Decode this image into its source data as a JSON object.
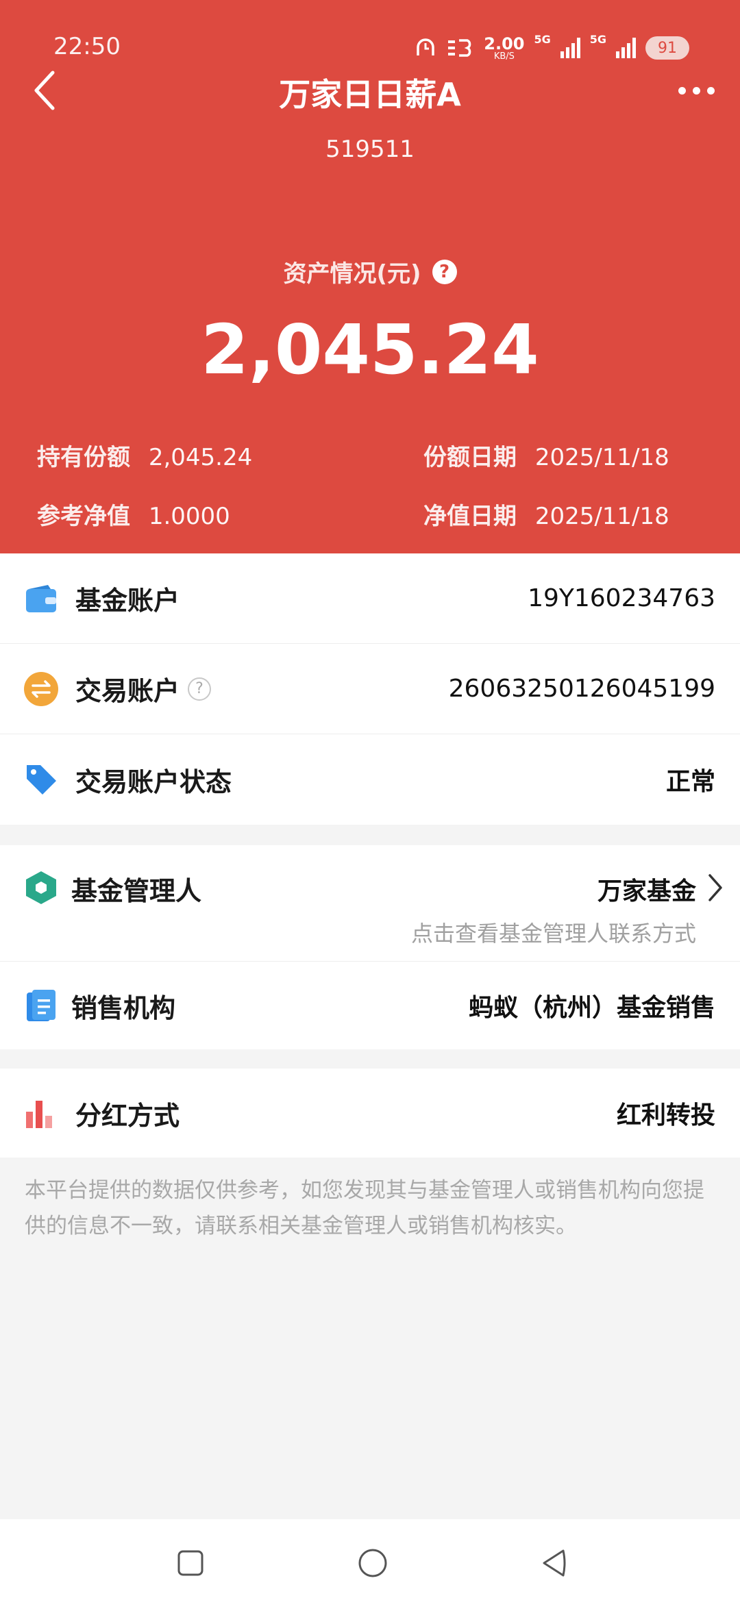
{
  "status_bar": {
    "time": "22:50",
    "speed_value": "2.00",
    "speed_unit": "KB/S",
    "net1": "5G",
    "net2": "5G",
    "battery": "91"
  },
  "nav": {
    "title": "万家日日薪A",
    "back_icon": "chevron-left-icon",
    "more_icon": "more-dots-icon"
  },
  "fund": {
    "code": "519511",
    "asset_label": "资产情况(元)",
    "asset_value": "2,045.24",
    "holding_label": "持有份额",
    "holding_value": "2,045.24",
    "share_date_label": "份额日期",
    "share_date_value": "2025/11/18",
    "nav_label": "参考净值",
    "nav_value": "1.0000",
    "nav_date_label": "净值日期",
    "nav_date_value": "2025/11/18"
  },
  "accounts": [
    {
      "label": "基金账户",
      "value": "19Y160234763",
      "icon": "wallet-icon"
    },
    {
      "label": "交易账户",
      "value": "2606325012604519​9",
      "icon": "exchange-icon"
    },
    {
      "label": "交易账户状态",
      "value": "正常",
      "icon": "tag-icon"
    }
  ],
  "manager": {
    "label": "基金管理人",
    "value": "万家基金",
    "sub": "点击查看基金管理人联系方式",
    "icon": "hexagon-icon"
  },
  "seller": {
    "label": "销售机构",
    "value": "蚂蚁（杭州）基金销售",
    "icon": "book-icon"
  },
  "dividend": {
    "label": "分红方式",
    "value": "红利转投",
    "icon": "bar-chart-icon"
  },
  "disclaimer": "本平台提供的数据仅供参考，如您发现其与基金管理人或销售机构向您提供的信息不一致，请联系相关基金管理人或销售机构核实。",
  "colors": {
    "header_bg": "#dd4a40",
    "page_bg": "#f4f4f4"
  }
}
